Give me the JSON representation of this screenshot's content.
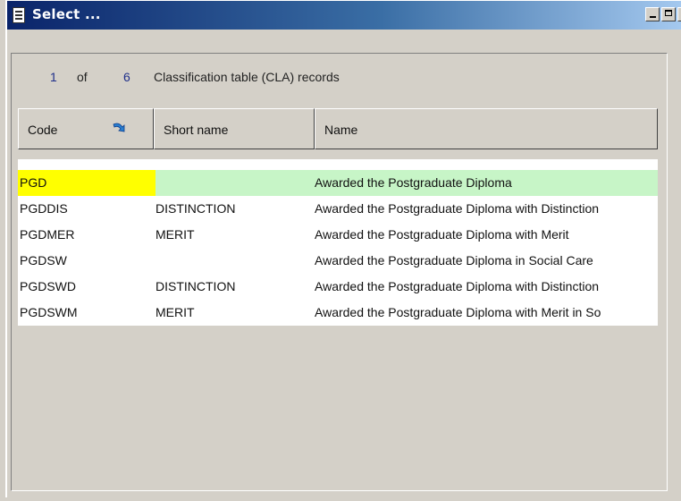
{
  "window": {
    "title": "Select ..."
  },
  "counter": {
    "current": "1",
    "of": "of",
    "total": "6",
    "description": "Classification table (CLA) records"
  },
  "columns": {
    "code": "Code",
    "short_name": "Short name",
    "name": "Name"
  },
  "rows": [
    {
      "code": "PGD",
      "short_name": "",
      "name": "Awarded the Postgraduate Diploma",
      "selected": true
    },
    {
      "code": "PGDDIS",
      "short_name": "DISTINCTION",
      "name": "Awarded the Postgraduate Diploma with Distinction"
    },
    {
      "code": "PGDMER",
      "short_name": "MERIT",
      "name": "Awarded the Postgraduate Diploma with Merit"
    },
    {
      "code": "PGDSW",
      "short_name": "",
      "name": "Awarded the Postgraduate Diploma in Social Care"
    },
    {
      "code": "PGDSWD",
      "short_name": "DISTINCTION",
      "name": "Awarded the Postgraduate Diploma with Distinction"
    },
    {
      "code": "PGDSWM",
      "short_name": "MERIT",
      "name": "Awarded the Postgraduate Diploma with Merit in So"
    }
  ],
  "colors": {
    "selected_row": "#c7f5c7",
    "selected_code": "#ffff00",
    "titlebar": "#0a246a"
  },
  "icons": {
    "app": "document-icon",
    "sort": "sort-arrow-icon"
  }
}
